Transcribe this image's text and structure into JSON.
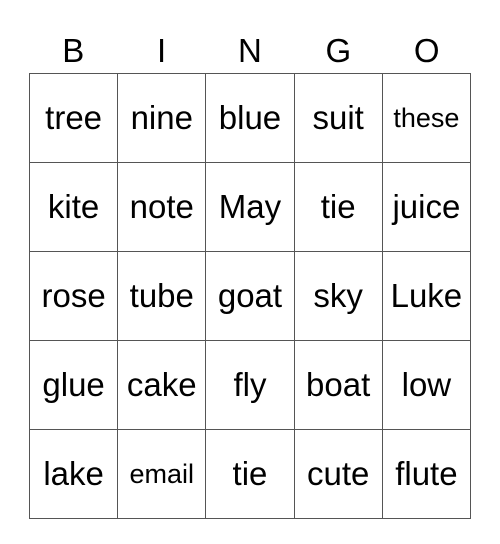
{
  "card": {
    "header": [
      "B",
      "I",
      "N",
      "G",
      "O"
    ],
    "rows": [
      [
        "tree",
        "nine",
        "blue",
        "suit",
        "these"
      ],
      [
        "kite",
        "note",
        "May",
        "tie",
        "juice"
      ],
      [
        "rose",
        "tube",
        "goat",
        "sky",
        "Luke"
      ],
      [
        "glue",
        "cake",
        "fly",
        "boat",
        "low"
      ],
      [
        "lake",
        "email",
        "tie",
        "cute",
        "flute"
      ]
    ]
  }
}
